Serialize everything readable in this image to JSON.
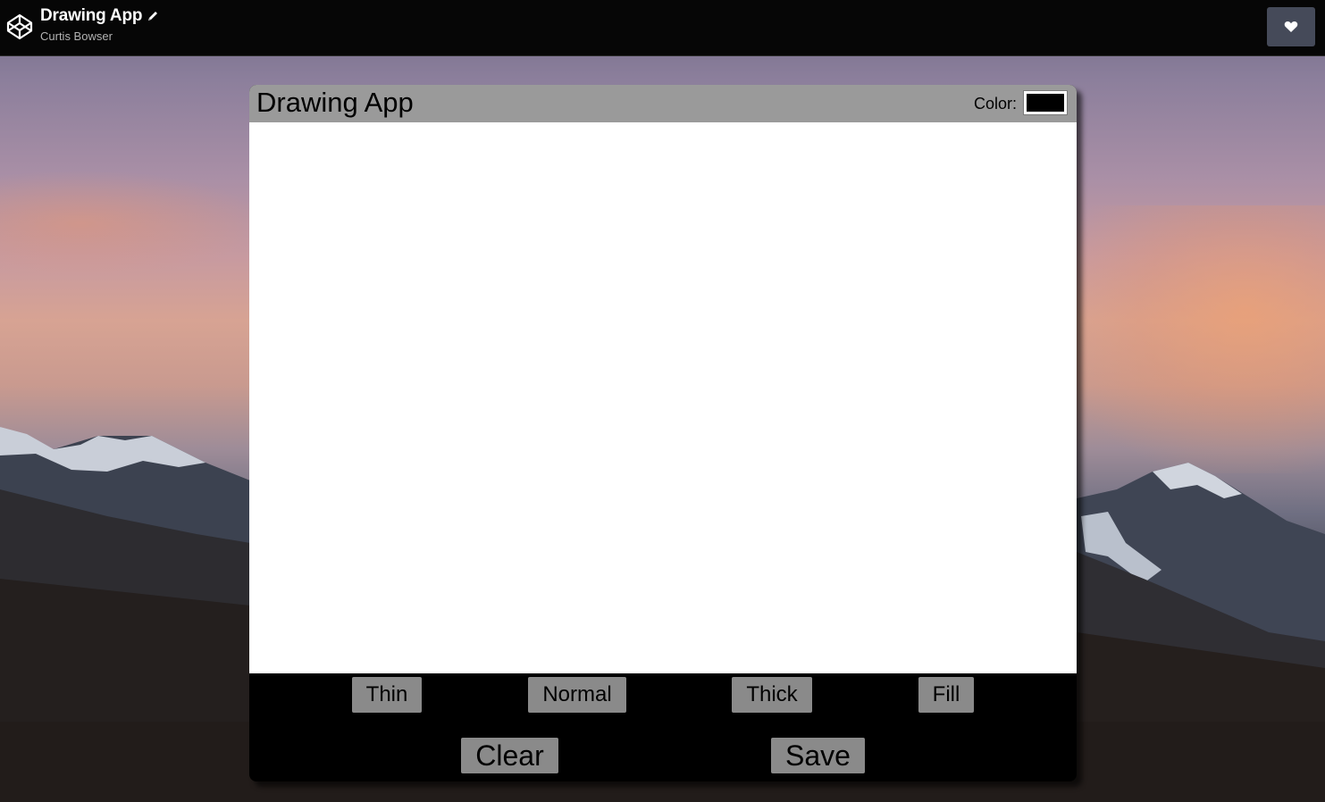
{
  "topbar": {
    "title": "Drawing App",
    "author": "Curtis Bowser",
    "logo_icon": "codepen-logo-icon",
    "edit_icon": "pencil-icon",
    "heart_icon": "heart-icon"
  },
  "app": {
    "title": "Drawing App",
    "color_label": "Color:",
    "selected_color": "#000000",
    "header_color": "#9a9a9a",
    "canvas_color": "#ffffff",
    "buttons": {
      "thin": "Thin",
      "normal": "Normal",
      "thick": "Thick",
      "fill": "Fill",
      "clear": "Clear",
      "save": "Save"
    }
  }
}
